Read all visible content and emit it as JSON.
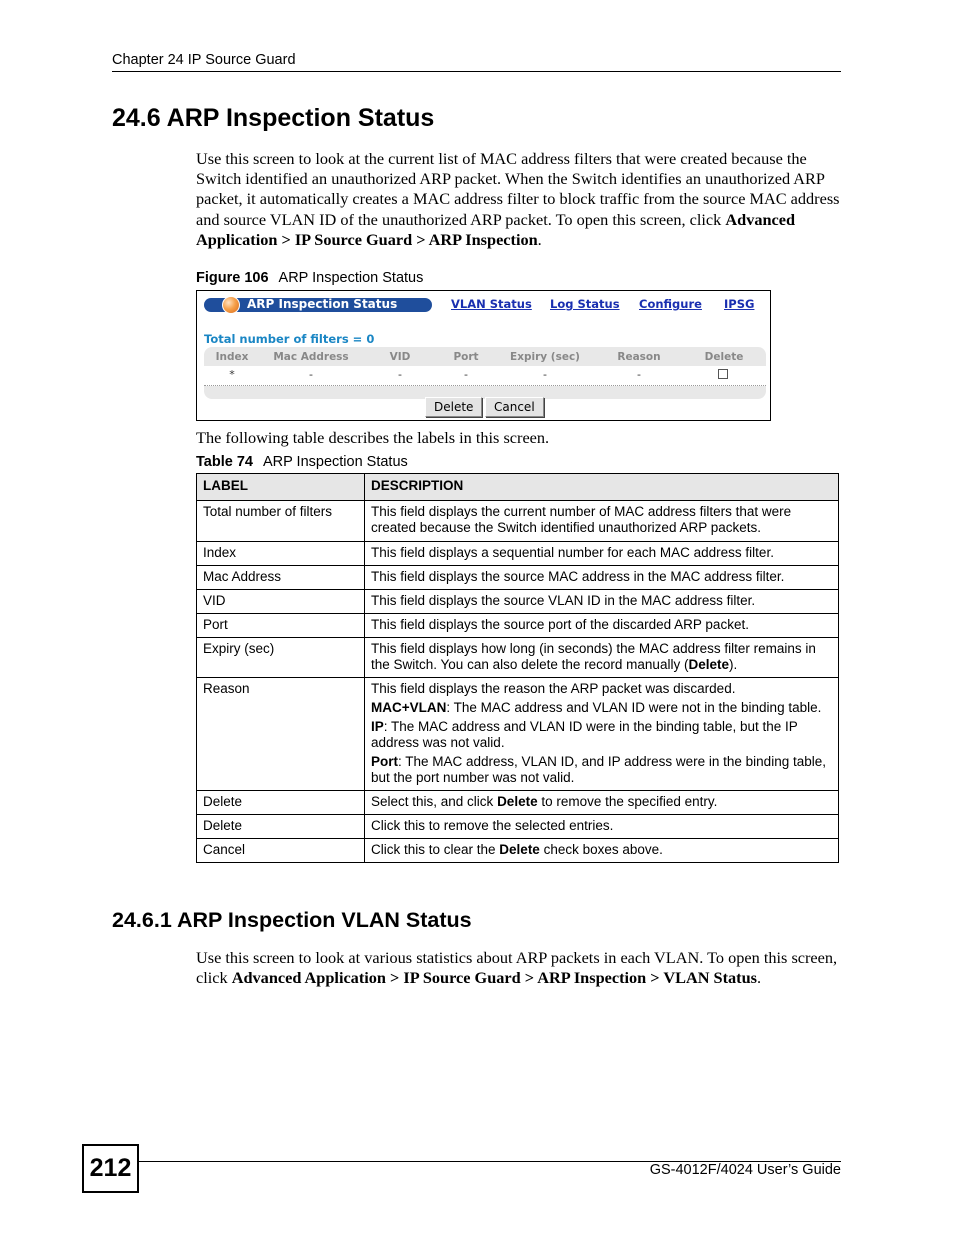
{
  "header": {
    "chapter": "Chapter 24 IP Source Guard"
  },
  "section": {
    "title": "24.6  ARP Inspection Status",
    "intro": {
      "text_before": "Use this screen to look at the current list of MAC address filters that were created because the Switch identified an unauthorized ARP packet. When the Switch identifies an unauthorized ARP packet, it automatically creates a MAC address filter to block traffic from the source MAC address and source VLAN ID of the unauthorized ARP packet. To open this screen, click ",
      "path": "Advanced Application > IP Source Guard > ARP Inspection",
      "text_after": "."
    }
  },
  "figure": {
    "number": "Figure 106",
    "title": "ARP Inspection Status",
    "active_tab": "ARP Inspection Status",
    "nav_links": [
      "VLAN Status",
      "Log Status",
      "Configure",
      "IPSG"
    ],
    "filters_label": "Total number of filters = 0",
    "columns": [
      "Index",
      "Mac Address",
      "VID",
      "Port",
      "Expiry (sec)",
      "Reason",
      "Delete"
    ],
    "row": [
      "*",
      "-",
      "-",
      "-",
      "-",
      "-"
    ],
    "delete_checked": false,
    "buttons": {
      "delete": "Delete",
      "cancel": "Cancel"
    }
  },
  "table_intro": "The following table describes the labels in this screen.",
  "table": {
    "number": "Table 74",
    "title": "ARP Inspection Status",
    "headers": [
      "LABEL",
      "DESCRIPTION"
    ],
    "rows": [
      {
        "label": "Total number of filters",
        "desc": "This field displays the current number of MAC address filters that were created because the Switch identified unauthorized ARP packets."
      },
      {
        "label": "Index",
        "desc": "This field displays a sequential number for each MAC address filter."
      },
      {
        "label": "Mac Address",
        "desc": "This field displays the source MAC address in the MAC address filter."
      },
      {
        "label": "VID",
        "desc": "This field displays the source VLAN ID in the MAC address filter."
      },
      {
        "label": "Port",
        "desc": "This field displays the source port of the discarded ARP packet."
      },
      {
        "label": "Expiry (sec)",
        "desc_before": "This field displays how long (in seconds) the MAC address filter remains in the Switch. You can also delete the record manually (",
        "desc_bold": "Delete",
        "desc_after": ")."
      },
      {
        "label": "Reason",
        "desc": "This field displays the reason the ARP packet was discarded.",
        "items": [
          {
            "term": "MAC+VLAN",
            "text": ": The MAC address and VLAN ID were not in the binding table."
          },
          {
            "term": "IP",
            "text": ": The MAC address and VLAN ID were in the binding table, but the IP address was not valid."
          },
          {
            "term": "Port",
            "text": ": The MAC address, VLAN ID, and IP address were in the binding table, but the port number was not valid."
          }
        ]
      },
      {
        "label": "Delete",
        "desc_before": "Select this, and click ",
        "desc_bold": "Delete",
        "desc_after": " to remove the specified entry."
      },
      {
        "label": "Delete",
        "desc": "Click this to remove the selected entries."
      },
      {
        "label": "Cancel",
        "desc_before": "Click this to clear the ",
        "desc_bold": "Delete",
        "desc_after": " check boxes above."
      }
    ]
  },
  "subsection": {
    "title": "24.6.1  ARP Inspection VLAN Status",
    "text_before": "Use this screen to look at various statistics about ARP packets in each VLAN. To open this screen, click ",
    "path": "Advanced Application > IP Source Guard > ARP Inspection > VLAN Status",
    "text_after": "."
  },
  "footer": {
    "page_number": "212",
    "guide": "GS-4012F/4024 User’s Guide"
  },
  "colors": {
    "tab_bar": "#1f4e9c",
    "link": "#1a2fb0",
    "filters_label": "#1a86c4",
    "table_header_bg": "#e6e6e6"
  }
}
